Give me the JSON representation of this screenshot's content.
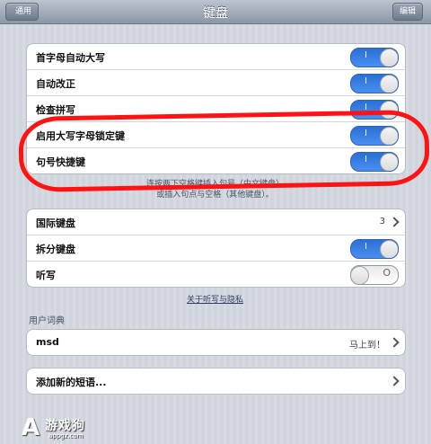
{
  "nav": {
    "title": "键盘",
    "back_label": "通用",
    "edit_label": "编辑"
  },
  "group1": {
    "rows": [
      {
        "label": "首字母自动大写",
        "on": true
      },
      {
        "label": "自动改正",
        "on": true
      },
      {
        "label": "检查拼写",
        "on": true
      },
      {
        "label": "启用大写字母锁定键",
        "on": true
      },
      {
        "label": "句号快捷键",
        "on": true
      }
    ],
    "footnote_line1": "连按两下空格键插入句号（中文键盘）",
    "footnote_line2": "或插入句点与空格（其他键盘）。"
  },
  "group2": {
    "international": {
      "label": "国际键盘",
      "value": "3"
    },
    "split": {
      "label": "拆分键盘",
      "on": true
    },
    "dictation": {
      "label": "听写",
      "on": false
    },
    "link": "关于听写与隐私"
  },
  "user_dictionary": {
    "header": "用户词典",
    "entry": {
      "label": "msd",
      "value": "马上到！"
    },
    "add": {
      "label": "添加新的短语..."
    }
  },
  "toggle": {
    "on_mark": "I",
    "off_mark": "O"
  },
  "watermark": {
    "logo": "A",
    "text": "游戏狗",
    "url": "appgz.com"
  },
  "colors": {
    "accent": "#2a6fd6",
    "highlight": "#ff1212"
  }
}
